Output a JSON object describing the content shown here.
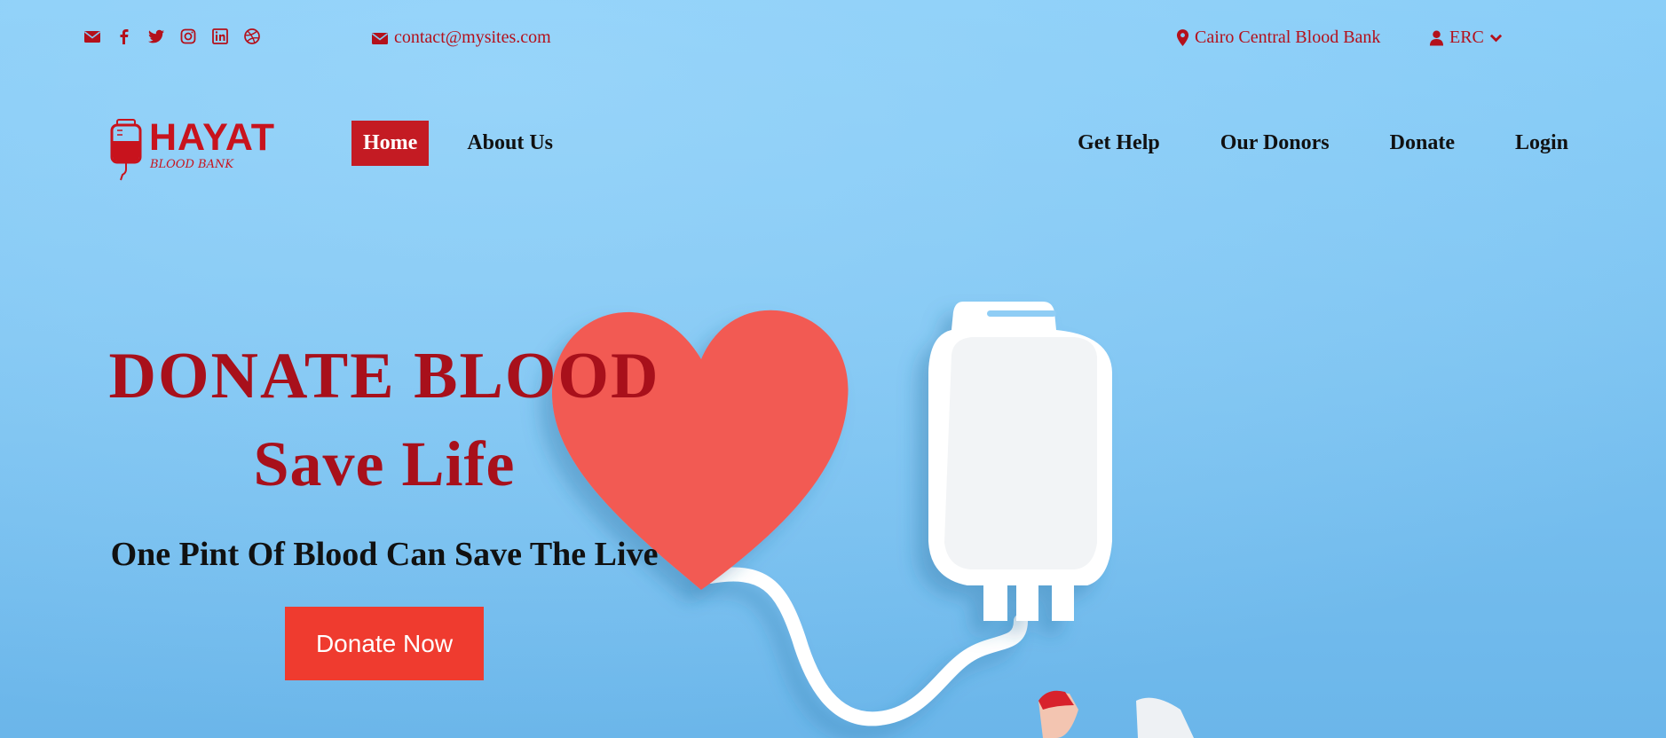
{
  "topbar": {
    "social_icons": [
      "envelope-icon",
      "facebook-icon",
      "twitter-icon",
      "instagram-icon",
      "linkedin-icon",
      "dribbble-icon"
    ],
    "email": "contact@mysites.com",
    "location": "Cairo Central Blood Bank",
    "user": "ERC"
  },
  "brand": {
    "name": "HAYAT",
    "tagline": "BLOOD BANK"
  },
  "nav": {
    "left": [
      {
        "label": "Home",
        "active": true
      },
      {
        "label": "About Us",
        "active": false
      }
    ],
    "right": [
      {
        "label": "Get Help"
      },
      {
        "label": "Our Donors"
      },
      {
        "label": "Donate"
      },
      {
        "label": "Login"
      }
    ]
  },
  "hero": {
    "title": "DONATE BLOOD",
    "subtitle": "Save Life",
    "tagline": "One Pint Of Blood Can Save The Live",
    "cta_label": "Donate Now"
  },
  "colors": {
    "brand_red": "#c41b23",
    "title_red": "#a8101b",
    "cta_red": "#ef3b2f",
    "background_blue": "#7cc3f1"
  }
}
